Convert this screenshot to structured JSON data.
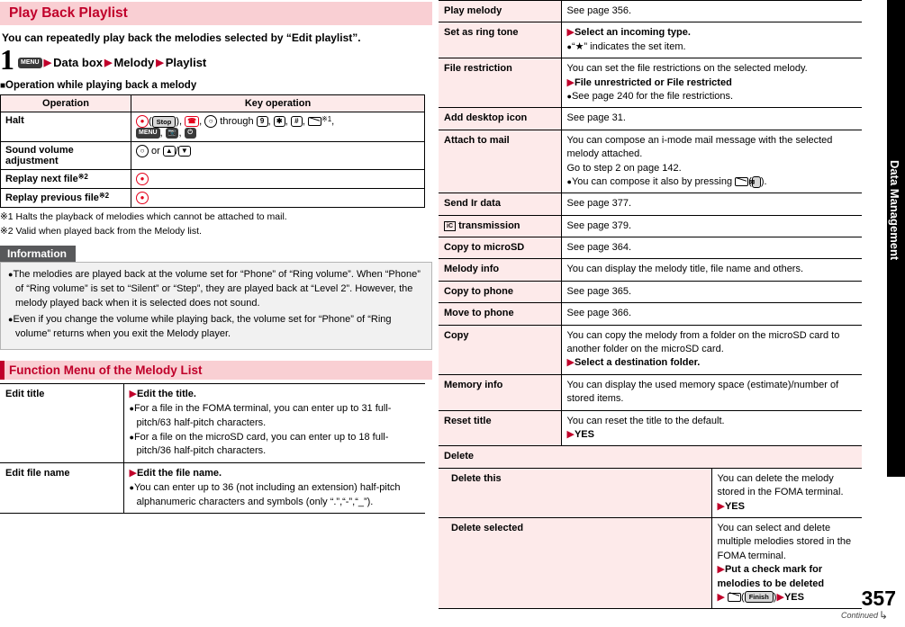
{
  "left": {
    "title": "Play Back Playlist",
    "intro": "You can repeatedly play back the melodies selected by “Edit playlist”.",
    "step": {
      "number": "1",
      "key": "MENU",
      "items": [
        "Data box",
        "Melody",
        "Playlist"
      ]
    },
    "subhead": "Operation while playing back a melody",
    "table": {
      "headers": [
        "Operation",
        "Key operation"
      ],
      "rows": [
        {
          "op": "Halt",
          "note": ""
        },
        {
          "op": "Sound volume adjustment",
          "note": ""
        },
        {
          "op": "Replay next file",
          "sup": "※2"
        },
        {
          "op": "Replay previous file",
          "sup": "※2"
        }
      ]
    },
    "footnotes": [
      "※1 Halts the playback of melodies which cannot be attached to mail.",
      "※2 Valid when played back from the Melody list."
    ],
    "information": {
      "heading": "Information",
      "items": [
        "The melodies are played back at the volume set for “Phone” of “Ring volume”. When “Phone” of “Ring volume” is set to “Silent” or “Step”, they are played back at “Level 2”. However, the melody played back when it is selected does not sound.",
        "Even if you change the volume while playing back, the volume set for “Phone” of “Ring volume” returns when you exit the Melody player."
      ]
    },
    "section_heading": "Function Menu of the Melody List",
    "fn_rows": [
      {
        "key": "Edit title",
        "lead": "Edit the title.",
        "bullets": [
          "For a file in the FOMA terminal, you can enter up to 31 full-pitch/63 half-pitch characters.",
          "For a file on the microSD card, you can enter up to 18 full-pitch/36 half-pitch characters."
        ]
      },
      {
        "key": "Edit file name",
        "lead": "Edit the file name.",
        "bullets": [
          "You can enter up to 36 (not including an extension) half-pitch alphanumeric characters and symbols (only “.”,“-”,“_”)."
        ]
      }
    ]
  },
  "right": {
    "rows": [
      {
        "key": "Play melody",
        "body": "See page 356."
      },
      {
        "key": "Set as ring tone",
        "lead": "Select an incoming type.",
        "bullets": [
          "“★” indicates the set item."
        ]
      },
      {
        "key": "File restriction",
        "body": "You can set the file restrictions on the selected melody.",
        "lead": "File unrestricted or File restricted",
        "bullets": [
          "See page 240 for the file restrictions."
        ]
      },
      {
        "key": "Add desktop icon",
        "body": "See page 31."
      },
      {
        "key": "Attach to mail",
        "body": "You can compose an i-mode mail message with the selected melody attached.\nGo to step 2 on page 142.",
        "bullets": [
          "You can compose it also by pressing"
        ],
        "bullet_suffix": "."
      },
      {
        "key": "Send Ir data",
        "body": "See page 377."
      },
      {
        "key": "transmission",
        "body": "See page 379.",
        "icon": "ic-icon"
      },
      {
        "key": "Copy to microSD",
        "body": "See page 364."
      },
      {
        "key": "Melody info",
        "body": "You can display the melody title, file name and others."
      },
      {
        "key": "Copy to phone",
        "body": "See page 365."
      },
      {
        "key": "Move to phone",
        "body": "See page 366."
      },
      {
        "key": "Copy",
        "body": "You can copy the melody from a folder on the microSD card to another folder on the microSD card.",
        "lead": "Select a destination folder."
      },
      {
        "key": "Memory info",
        "body": "You can display the used memory space (estimate)/number of stored items."
      },
      {
        "key": "Reset title",
        "body": "You can reset the title to the default.",
        "lead": "YES"
      }
    ],
    "delete": {
      "key": "Delete",
      "sub": [
        {
          "key": "Delete this",
          "body": "You can delete the melody stored in the FOMA terminal.",
          "lead": "YES"
        },
        {
          "key": "Delete selected",
          "body": "You can select and delete multiple melodies stored in the FOMA terminal.",
          "lead": "Put a check mark for melodies to be deleted",
          "lead2": "YES",
          "finish": "Finish"
        }
      ]
    }
  },
  "side_tab": "Data Management",
  "page_number": "357",
  "continued": "Continued"
}
